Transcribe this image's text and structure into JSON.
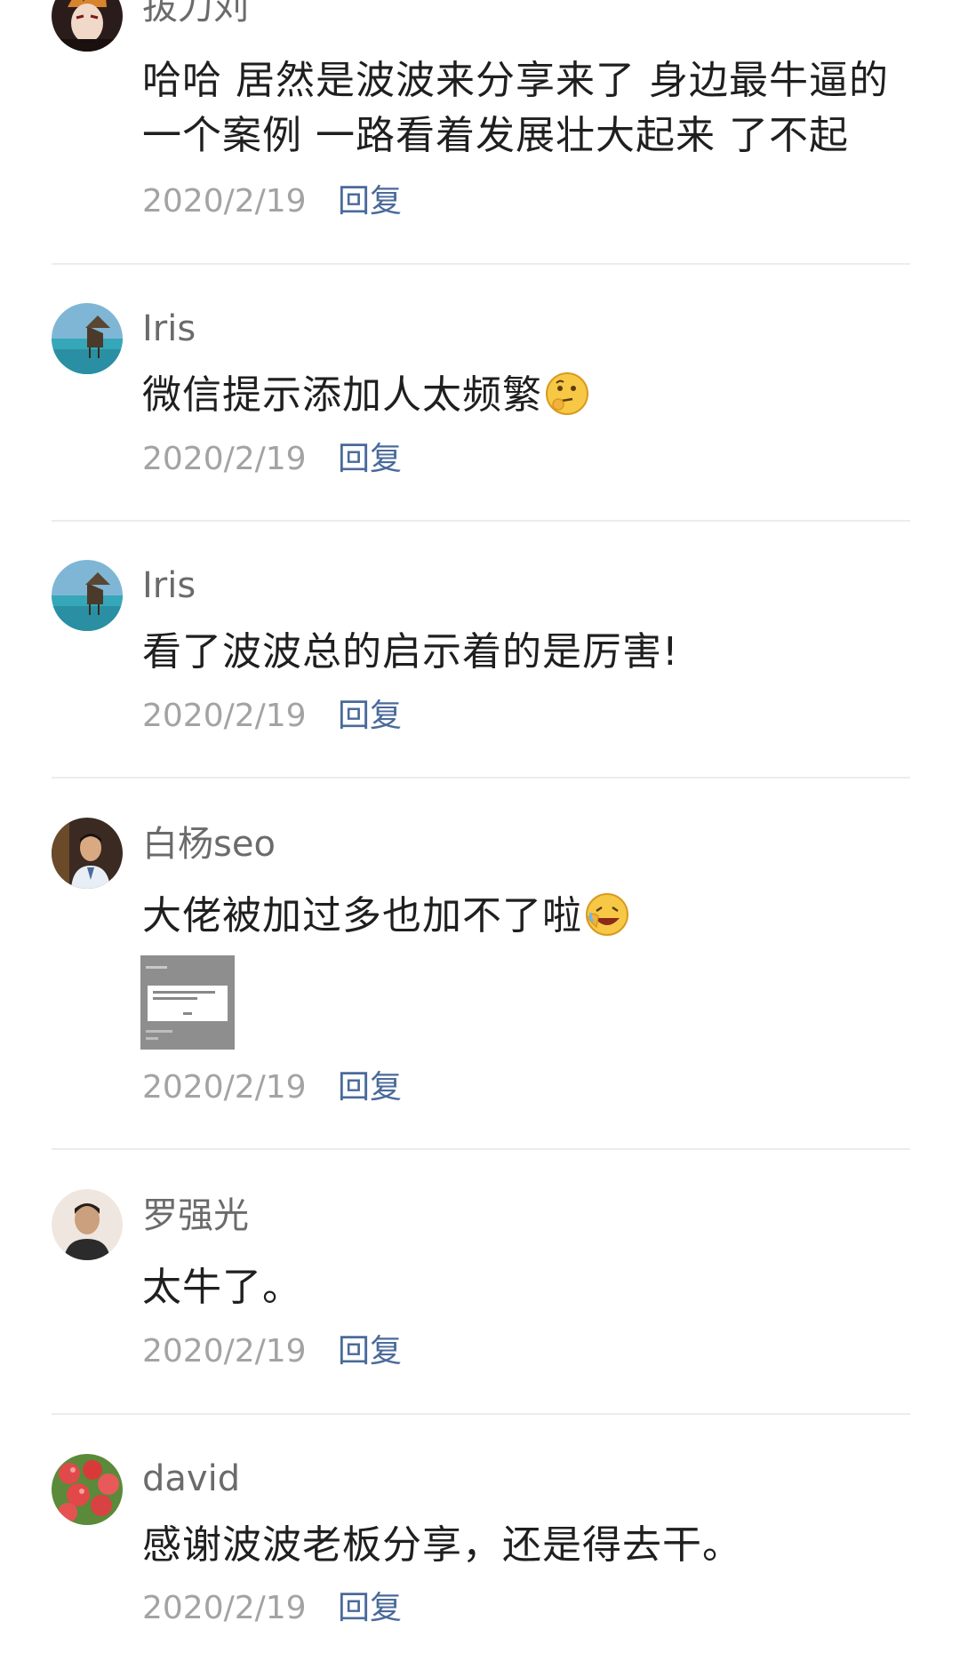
{
  "comments": [
    {
      "username": "拔刀刘",
      "text": "哈哈 居然是波波来分享来了 身边最牛逼的一个案例 一路看着发展壮大起来 了不起",
      "date": "2020/2/19",
      "reply": "回复"
    },
    {
      "username": "Iris",
      "text": "微信提示添加人太频繁",
      "date": "2020/2/19",
      "reply": "回复"
    },
    {
      "username": "Iris",
      "text": "看了波波总的启示着的是厉害!",
      "date": "2020/2/19",
      "reply": "回复"
    },
    {
      "username": "白杨seo",
      "text": "大佬被加过多也加不了啦",
      "date": "2020/2/19",
      "reply": "回复"
    },
    {
      "username": "罗强光",
      "text": "太牛了。",
      "date": "2020/2/19",
      "reply": "回复"
    },
    {
      "username": "david",
      "text": "感谢波波老板分享，还是得去干。",
      "date": "2020/2/19",
      "reply": "回复"
    }
  ],
  "icons": {
    "emoji_1": "thinking-face-emoji-icon",
    "emoji_2": "laughing-face-emoji-icon"
  },
  "colors": {
    "username": "#6b6b6b",
    "content": "#1f1f1f",
    "date": "#a3a3a3",
    "reply": "#4a6a9a",
    "divider": "#ececec"
  }
}
